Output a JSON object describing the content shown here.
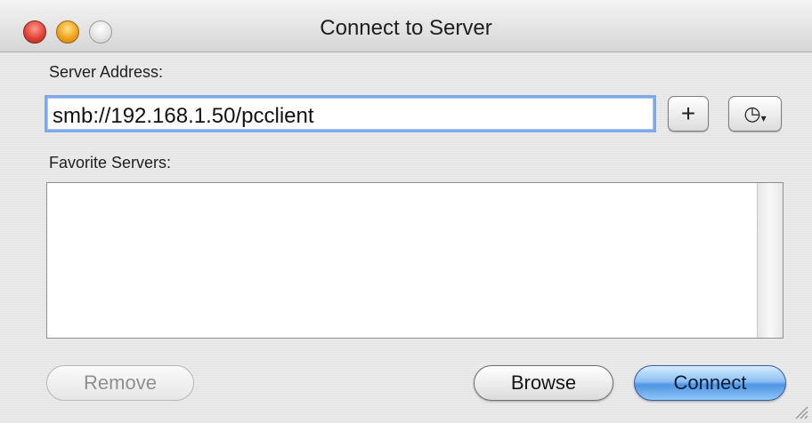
{
  "window": {
    "title": "Connect to Server"
  },
  "window_controls": {
    "close_color": "#e0443a",
    "minimize_color": "#f0a21e",
    "zoom_color": "#e2e2e2"
  },
  "server_address": {
    "label": "Server Address:",
    "value": "smb://192.168.1.50/pcclient"
  },
  "buttons": {
    "add_label": "+",
    "recent_icon": "clock-icon",
    "recent_glyph": "◷",
    "recent_arrow": "▾"
  },
  "favorites": {
    "label": "Favorite Servers:",
    "items": []
  },
  "footer": {
    "remove_label": "Remove",
    "browse_label": "Browse",
    "connect_label": "Connect"
  },
  "colors": {
    "default_button": "#4f95e2",
    "focus_ring": "#7ea8e8"
  }
}
